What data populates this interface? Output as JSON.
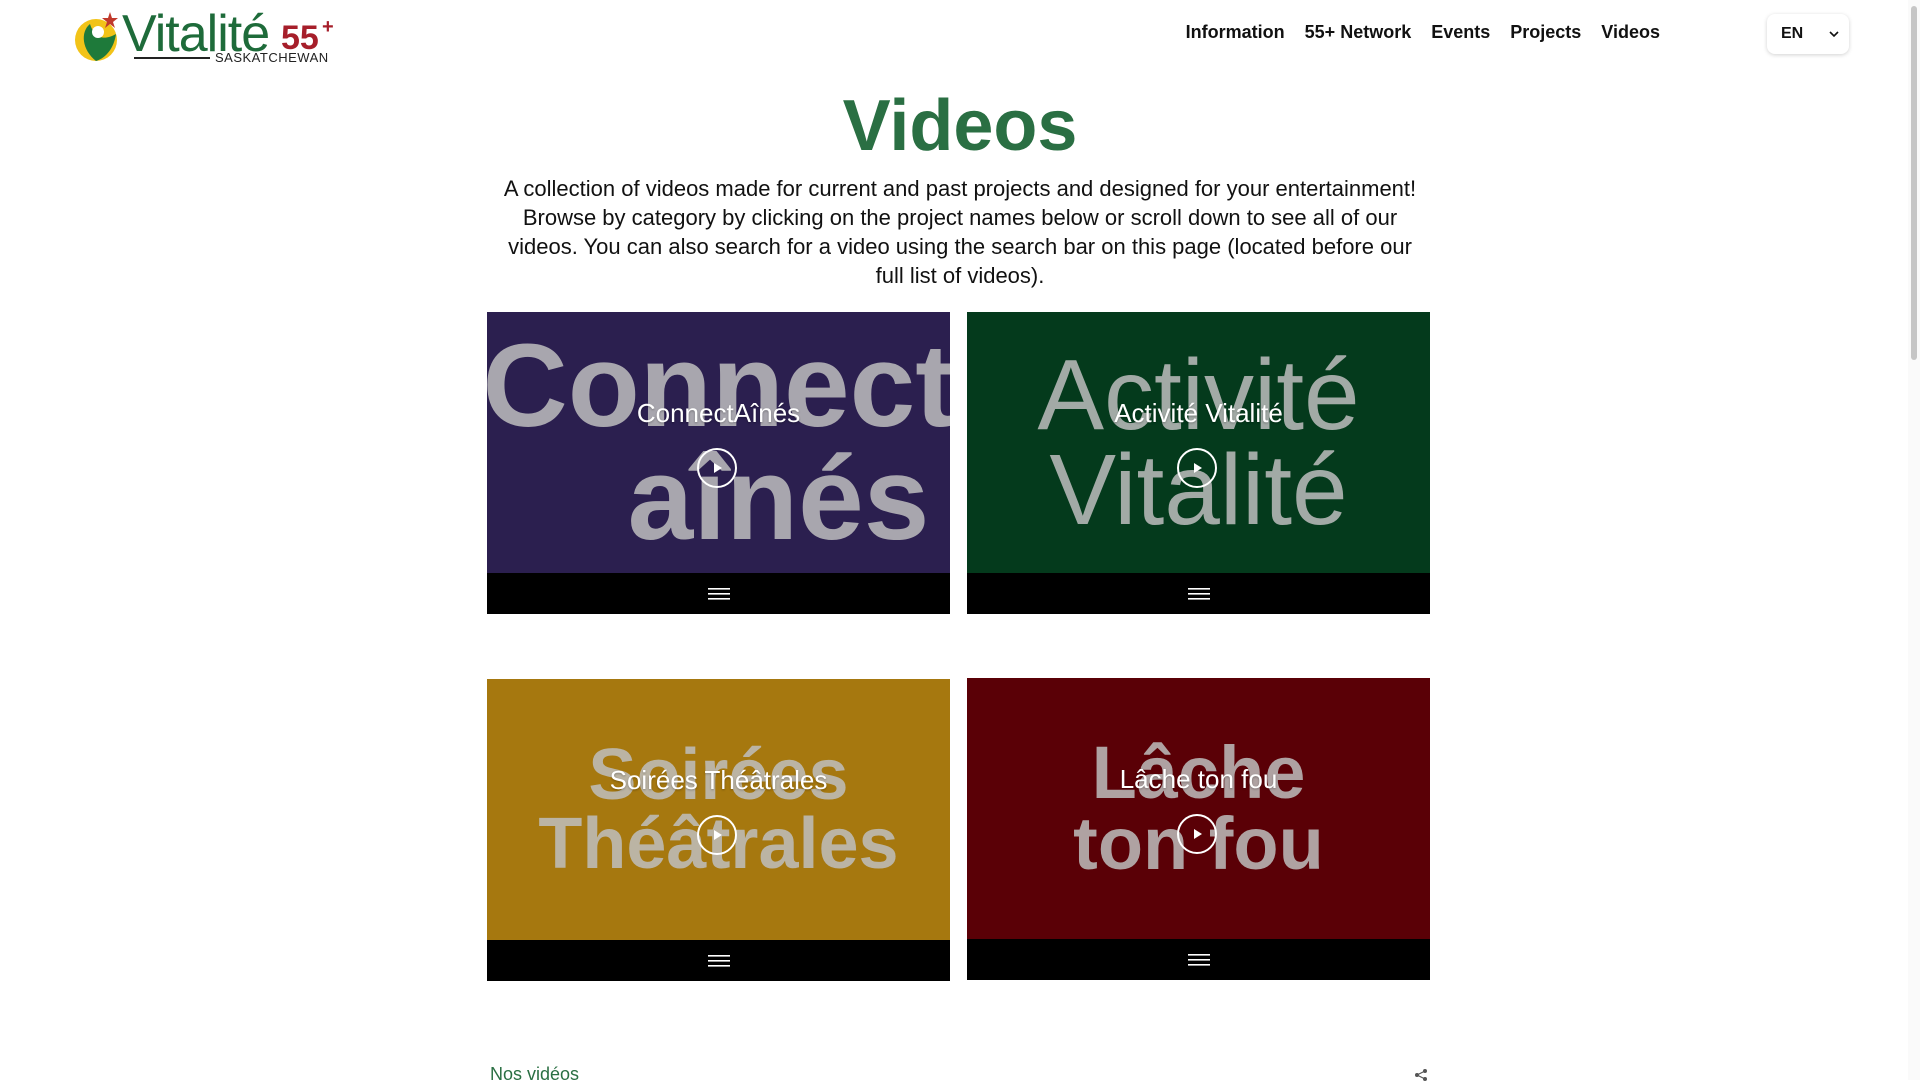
{
  "logo": {
    "word": "Vitalité",
    "number": "55",
    "plus": "+",
    "subtitle": "SASKATCHEWAN"
  },
  "nav": {
    "items": [
      "Information",
      "55+ Network",
      "Events",
      "Projects",
      "Videos"
    ]
  },
  "lang": {
    "label": "EN"
  },
  "page": {
    "title": "Videos",
    "intro": "A collection of videos made for current and past projects and designed for your entertainment! Browse by category by clicking on the project names below or scroll down to see all of our videos. You can also search for a video using the search bar on this page (located before our full list of videos)."
  },
  "cards": [
    {
      "title": "ConnectAînés",
      "art_line1": "Connect",
      "art_line2": "aînés",
      "color": "#2b1f4f"
    },
    {
      "title": "Activité Vitalité",
      "art_line1": "Activité",
      "art_line2": "Vitalité",
      "color": "#043a1c"
    },
    {
      "title": "Soirées Théâtrales",
      "art_line1": "Soirées",
      "art_line2": "Théâtrales",
      "color": "#a6780f"
    },
    {
      "title": "Lâche ton fou",
      "art_line1": "Lâche",
      "art_line2": "ton fou",
      "color": "#5a0006"
    }
  ],
  "section": {
    "label": "Nos vidéos"
  },
  "icons": {
    "logo": "vitalite-logo-icon",
    "chevron": "chevron-down-icon",
    "play": "play-icon",
    "menu": "menu-icon",
    "share": "share-icon"
  }
}
